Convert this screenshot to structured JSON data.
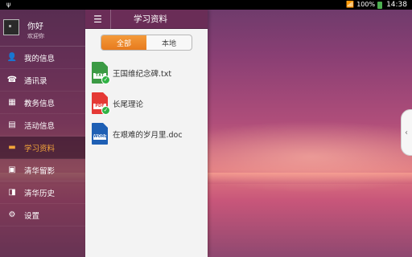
{
  "statusbar": {
    "usb_icon": "usb-icon",
    "battery_text": "100%",
    "time": "14:38"
  },
  "drawer": {
    "greeting": "你好",
    "welcome": "欢迎你",
    "items": [
      {
        "label": "我的信息",
        "icon": "person-icon",
        "glyph": "👤",
        "active": false
      },
      {
        "label": "通讯录",
        "icon": "phone-icon",
        "glyph": "☎",
        "active": false
      },
      {
        "label": "教务信息",
        "icon": "academic-icon",
        "glyph": "▦",
        "active": false
      },
      {
        "label": "活动信息",
        "icon": "document-icon",
        "glyph": "▤",
        "active": false
      },
      {
        "label": "学习资料",
        "icon": "folder-icon",
        "glyph": "▬",
        "active": true
      },
      {
        "label": "清华留影",
        "icon": "photo-icon",
        "glyph": "▣",
        "active": false
      },
      {
        "label": "清华历史",
        "icon": "history-icon",
        "glyph": "◨",
        "active": false
      },
      {
        "label": "设置",
        "icon": "gear-icon",
        "glyph": "⚙",
        "active": false
      }
    ]
  },
  "panel": {
    "title": "学习资料",
    "tabs": {
      "all": "全部",
      "local": "本地"
    },
    "files": [
      {
        "name": "王国维纪念碑.txt",
        "type_label": "TXT",
        "color": "#3b9a44",
        "downloaded": true
      },
      {
        "name": "长尾理论",
        "type_label": "PDF",
        "color": "#e53935",
        "downloaded": true
      },
      {
        "name": "在艰难的岁月里.doc",
        "type_label": "WORD",
        "color": "#1e5fb4",
        "downloaded": false
      }
    ]
  },
  "colors": {
    "accent": "#e77b1e",
    "header": "#6a2d57"
  }
}
